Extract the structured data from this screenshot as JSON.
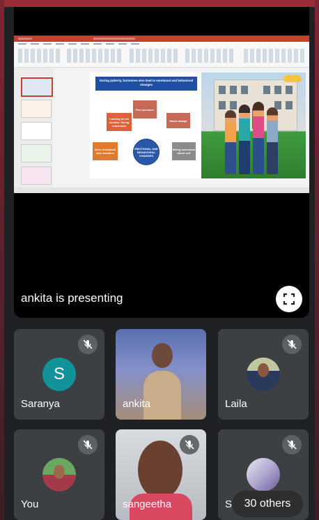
{
  "presentation": {
    "label": "ankita is presenting",
    "slide_heading": "During puberty, hormones also lead to emotional and behavioral changes",
    "slide_center": "EMOTIONAL AND BEHAVIORAL CHANGES",
    "slide_boxes": [
      "Looking for an identity / Being conscious",
      "Peer pressure",
      "Mood swings",
      "Being conscious about self",
      "More emotional and sensitive"
    ]
  },
  "participants": [
    {
      "name": "Saranya",
      "initial": "S",
      "muted": true,
      "avatar_color": "#12939a"
    },
    {
      "name": "ankita",
      "muted": false
    },
    {
      "name": "Laila",
      "muted": true
    },
    {
      "name": "You",
      "muted": true
    },
    {
      "name": "sangeetha",
      "muted": true
    },
    {
      "name": "S",
      "muted": true
    }
  ],
  "others": {
    "label": "30 others"
  },
  "colors": {
    "background": "#202124",
    "tile": "#3c4043",
    "accent": "#c4422b",
    "frame": "#9b2d3a"
  }
}
